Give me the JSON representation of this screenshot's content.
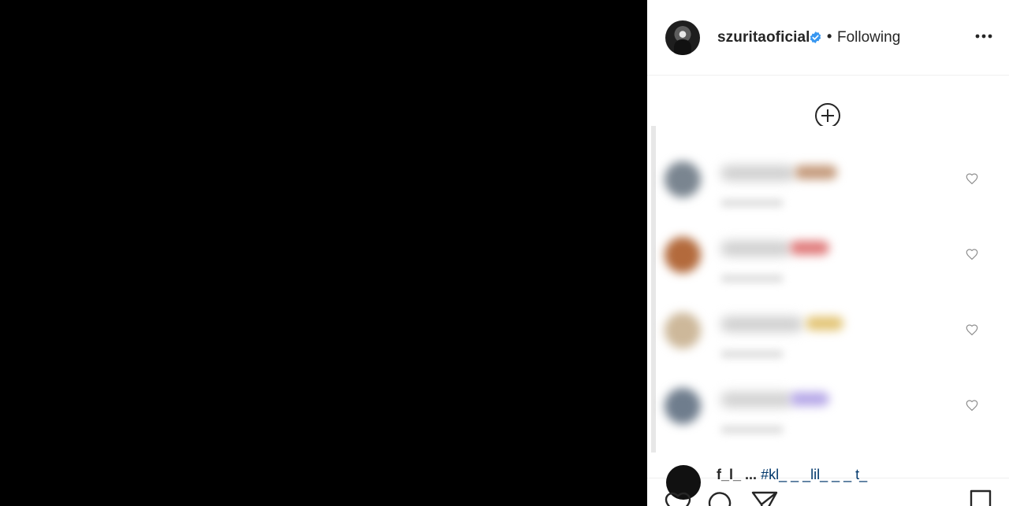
{
  "header": {
    "username": "szuritaoficial",
    "separator": "•",
    "follow_status": "Following",
    "verified": true
  },
  "comments": [
    {
      "avatar_color": "#7a8590",
      "name_color": "#cfcfcf",
      "emoji_color": "#c49a7b"
    },
    {
      "avatar_color": "#b36a3c",
      "name_color": "#cfcfcf",
      "emoji_color": "#e07b7b"
    },
    {
      "avatar_color": "#cdb89a",
      "name_color": "#cfcfcf",
      "emoji_color": "#e3c576"
    },
    {
      "avatar_color": "#6f7d8d",
      "name_color": "#d2d2d2",
      "emoji_color": "#b7a9e8"
    }
  ],
  "caption": {
    "username_fragment": "f_l_",
    "text_fragment": "...",
    "hashtag_fragment": "#kl_ _ _lil_ _ _ t_"
  },
  "colors": {
    "text": "#262626",
    "verified_blue": "#3897f0",
    "divider": "#efefef",
    "link": "#00376b"
  },
  "icons": {
    "more": "more-options-icon",
    "load_more": "load-more-comments-icon",
    "like": "heart-icon",
    "comment": "comment-icon",
    "share": "share-icon",
    "save": "bookmark-icon"
  }
}
